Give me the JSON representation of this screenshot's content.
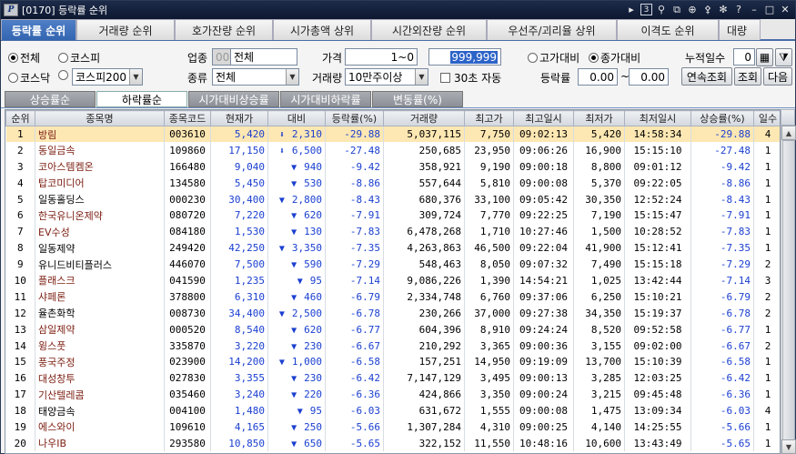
{
  "window": {
    "logo": "P",
    "title": "[0170] 등락률 순위",
    "page_box": "3"
  },
  "top_tabs": [
    "등락률 순위",
    "거래량 순위",
    "호가잔량 순위",
    "시가총액 상위",
    "시간외잔량 순위",
    "우선주/괴리율 상위",
    "이격도 순위",
    "대량"
  ],
  "form": {
    "market_all": "전체",
    "market_kospi": "코스피",
    "market_kosdaq": "코스닥",
    "index_select": "코스피200",
    "sector_label": "업종",
    "sector_code": "0000",
    "sector_name": "전체",
    "kind_label": "종류",
    "kind_value": "전체",
    "price_label": "가격",
    "price_from": "1",
    "price_sep": "~0",
    "price_to": "999,999",
    "volume_label": "거래량",
    "volume_value": "10만주이상",
    "auto_label": "30초 자동",
    "vs_high": "고가대비",
    "vs_close": "종가대비",
    "rate_label": "등락률",
    "rate_from": "0.00",
    "rate_sep": "~",
    "rate_to": "0.00",
    "days_label": "누적일수",
    "days_value": "0",
    "continuous_btn": "연속조회",
    "query_btn": "조회",
    "next_btn": "다음"
  },
  "sub_tabs": [
    "상승률순",
    "하락률순",
    "시가대비상승률",
    "시가대비하락률",
    "변동률(%)"
  ],
  "columns": [
    "순위",
    "종목명",
    "종목코드",
    "현재가",
    "대비",
    "등락률(%)",
    "거래량",
    "최고가",
    "최고일시",
    "최저가",
    "최저일시",
    "상승률(%)",
    "일수"
  ],
  "colors": {
    "down": "#1a3fd0",
    "selected_row": "#fde7b3",
    "tab_active": "#3465b0"
  },
  "rows": [
    {
      "rank": "1",
      "name": "방림",
      "code": "003610",
      "price": "5,420",
      "arrow": "⬇",
      "diff": "2,310",
      "rate": "-29.88",
      "volume": "5,037,115",
      "high": "7,750",
      "high_time": "09:02:13",
      "low": "5,420",
      "low_time": "14:58:34",
      "up_rate": "-29.88",
      "days": "4"
    },
    {
      "rank": "2",
      "name": "동일금속",
      "code": "109860",
      "price": "17,150",
      "arrow": "⬇",
      "diff": "6,500",
      "rate": "-27.48",
      "volume": "250,685",
      "high": "23,950",
      "high_time": "09:06:26",
      "low": "16,900",
      "low_time": "15:15:10",
      "up_rate": "-27.48",
      "days": "1"
    },
    {
      "rank": "3",
      "name": "코아스템켐온",
      "code": "166480",
      "price": "9,040",
      "arrow": "▼",
      "diff": "940",
      "rate": "-9.42",
      "volume": "358,921",
      "high": "9,190",
      "high_time": "09:00:18",
      "low": "8,800",
      "low_time": "09:01:12",
      "up_rate": "-9.42",
      "days": "1"
    },
    {
      "rank": "4",
      "name": "탑코미디어",
      "code": "134580",
      "price": "5,450",
      "arrow": "▼",
      "diff": "530",
      "rate": "-8.86",
      "volume": "557,644",
      "high": "5,810",
      "high_time": "09:00:08",
      "low": "5,370",
      "low_time": "09:22:05",
      "up_rate": "-8.86",
      "days": "1"
    },
    {
      "rank": "5",
      "name": "일동홀딩스",
      "code": "000230",
      "price": "30,400",
      "arrow": "▼",
      "diff": "2,800",
      "rate": "-8.43",
      "volume": "680,376",
      "high": "33,100",
      "high_time": "09:05:42",
      "low": "30,350",
      "low_time": "12:52:24",
      "up_rate": "-8.43",
      "days": "1"
    },
    {
      "rank": "6",
      "name": "한국유니온제약",
      "code": "080720",
      "price": "7,220",
      "arrow": "▼",
      "diff": "620",
      "rate": "-7.91",
      "volume": "309,724",
      "high": "7,770",
      "high_time": "09:22:25",
      "low": "7,190",
      "low_time": "15:15:47",
      "up_rate": "-7.91",
      "days": "1"
    },
    {
      "rank": "7",
      "name": "EV수성",
      "code": "084180",
      "price": "1,530",
      "arrow": "▼",
      "diff": "130",
      "rate": "-7.83",
      "volume": "6,478,268",
      "high": "1,710",
      "high_time": "10:27:46",
      "low": "1,500",
      "low_time": "10:28:52",
      "up_rate": "-7.83",
      "days": "1"
    },
    {
      "rank": "8",
      "name": "일동제약",
      "code": "249420",
      "price": "42,250",
      "arrow": "▼",
      "diff": "3,350",
      "rate": "-7.35",
      "volume": "4,263,863",
      "high": "46,500",
      "high_time": "09:22:04",
      "low": "41,900",
      "low_time": "15:12:41",
      "up_rate": "-7.35",
      "days": "1"
    },
    {
      "rank": "9",
      "name": "유니드비티플러스",
      "code": "446070",
      "price": "7,500",
      "arrow": "▼",
      "diff": "590",
      "rate": "-7.29",
      "volume": "548,463",
      "high": "8,050",
      "high_time": "09:07:32",
      "low": "7,490",
      "low_time": "15:15:18",
      "up_rate": "-7.29",
      "days": "2"
    },
    {
      "rank": "10",
      "name": "플래스크",
      "code": "041590",
      "price": "1,235",
      "arrow": "▼",
      "diff": "95",
      "rate": "-7.14",
      "volume": "9,086,226",
      "high": "1,390",
      "high_time": "14:54:21",
      "low": "1,025",
      "low_time": "13:42:44",
      "up_rate": "-7.14",
      "days": "3"
    },
    {
      "rank": "11",
      "name": "샤페론",
      "code": "378800",
      "price": "6,310",
      "arrow": "▼",
      "diff": "460",
      "rate": "-6.79",
      "volume": "2,334,748",
      "high": "6,760",
      "high_time": "09:37:06",
      "low": "6,250",
      "low_time": "15:10:21",
      "up_rate": "-6.79",
      "days": "2"
    },
    {
      "rank": "12",
      "name": "율촌화학",
      "code": "008730",
      "price": "34,400",
      "arrow": "▼",
      "diff": "2,500",
      "rate": "-6.78",
      "volume": "230,266",
      "high": "37,000",
      "high_time": "09:27:38",
      "low": "34,350",
      "low_time": "15:19:37",
      "up_rate": "-6.78",
      "days": "2"
    },
    {
      "rank": "13",
      "name": "삼일제약",
      "code": "000520",
      "price": "8,540",
      "arrow": "▼",
      "diff": "620",
      "rate": "-6.77",
      "volume": "604,396",
      "high": "8,910",
      "high_time": "09:24:24",
      "low": "8,520",
      "low_time": "09:52:58",
      "up_rate": "-6.77",
      "days": "1"
    },
    {
      "rank": "14",
      "name": "윙스풋",
      "code": "335870",
      "price": "3,220",
      "arrow": "▼",
      "diff": "230",
      "rate": "-6.67",
      "volume": "210,292",
      "high": "3,365",
      "high_time": "09:00:36",
      "low": "3,155",
      "low_time": "09:02:00",
      "up_rate": "-6.67",
      "days": "2"
    },
    {
      "rank": "15",
      "name": "풍국주정",
      "code": "023900",
      "price": "14,200",
      "arrow": "▼",
      "diff": "1,000",
      "rate": "-6.58",
      "volume": "157,251",
      "high": "14,950",
      "high_time": "09:19:09",
      "low": "13,700",
      "low_time": "15:10:39",
      "up_rate": "-6.58",
      "days": "1"
    },
    {
      "rank": "16",
      "name": "대성창투",
      "code": "027830",
      "price": "3,355",
      "arrow": "▼",
      "diff": "230",
      "rate": "-6.42",
      "volume": "7,147,129",
      "high": "3,495",
      "high_time": "09:00:13",
      "low": "3,285",
      "low_time": "12:03:25",
      "up_rate": "-6.42",
      "days": "1"
    },
    {
      "rank": "17",
      "name": "기산텔레콤",
      "code": "035460",
      "price": "3,240",
      "arrow": "▼",
      "diff": "220",
      "rate": "-6.36",
      "volume": "424,866",
      "high": "3,350",
      "high_time": "09:00:24",
      "low": "3,215",
      "low_time": "09:45:48",
      "up_rate": "-6.36",
      "days": "1"
    },
    {
      "rank": "18",
      "name": "태양금속",
      "code": "004100",
      "price": "1,480",
      "arrow": "▼",
      "diff": "95",
      "rate": "-6.03",
      "volume": "631,672",
      "high": "1,555",
      "high_time": "09:00:08",
      "low": "1,475",
      "low_time": "13:09:34",
      "up_rate": "-6.03",
      "days": "4"
    },
    {
      "rank": "19",
      "name": "에스와이",
      "code": "109610",
      "price": "4,165",
      "arrow": "▼",
      "diff": "250",
      "rate": "-5.66",
      "volume": "1,307,284",
      "high": "4,310",
      "high_time": "09:00:25",
      "low": "4,140",
      "low_time": "14:25:55",
      "up_rate": "-5.66",
      "days": "1"
    },
    {
      "rank": "20",
      "name": "나우IB",
      "code": "293580",
      "price": "10,850",
      "arrow": "▼",
      "diff": "650",
      "rate": "-5.65",
      "volume": "322,152",
      "high": "11,550",
      "high_time": "10:48:16",
      "low": "10,600",
      "low_time": "13:43:49",
      "up_rate": "-5.65",
      "days": "1"
    }
  ],
  "name_colors": [
    "#7b1c10",
    "#7b1c10",
    "#7b1c10",
    "#7b1c10",
    "#000000",
    "#7b1c10",
    "#7b1c10",
    "#000000",
    "#000000",
    "#7b1c10",
    "#7b1c10",
    "#000000",
    "#7b1c10",
    "#7b1c10",
    "#7b1c10",
    "#7b1c10",
    "#7b1c10",
    "#000000",
    "#7b1c10",
    "#7b1c10"
  ]
}
